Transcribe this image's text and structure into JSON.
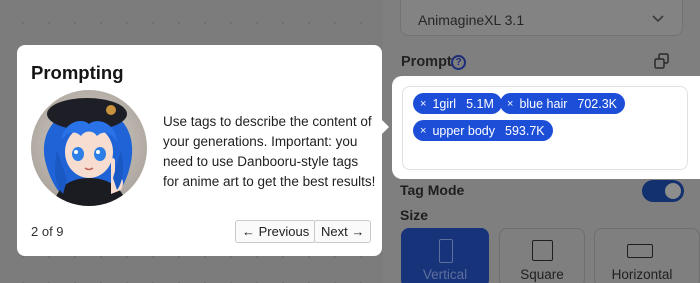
{
  "settings": {
    "model": {
      "selected": "AnimagineXL 3.1"
    },
    "prompt": {
      "title": "Prompt",
      "tags": [
        {
          "name": "1girl",
          "count": "5.1M",
          "remove": "×"
        },
        {
          "name": "blue hair",
          "count": "702.3K",
          "remove": "×"
        },
        {
          "name": "upper body",
          "count": "593.7K",
          "remove": "×"
        }
      ]
    },
    "tag_mode": {
      "label": "Tag Mode",
      "enabled": true
    },
    "size": {
      "label": "Size",
      "options": [
        {
          "label": "Vertical",
          "selected": true
        },
        {
          "label": "Square",
          "selected": false
        },
        {
          "label": "Horizontal",
          "selected": false
        }
      ]
    }
  },
  "tour": {
    "title": "Prompting",
    "body": "Use tags to describe the content of your generations. Important: you need to use Danbooru-style tags for anime art to get the best results!",
    "step": "2 of 9",
    "prev_label": "← Previous",
    "next_label": "Next →"
  },
  "colors": {
    "tag_bg": "#1d4ed8",
    "overlay_bg": "#7c7c7c",
    "selected_option_bg": "#17337a"
  },
  "icons": [
    "chevron-down-icon",
    "help-icon",
    "copy-icon",
    "close-icon"
  ]
}
